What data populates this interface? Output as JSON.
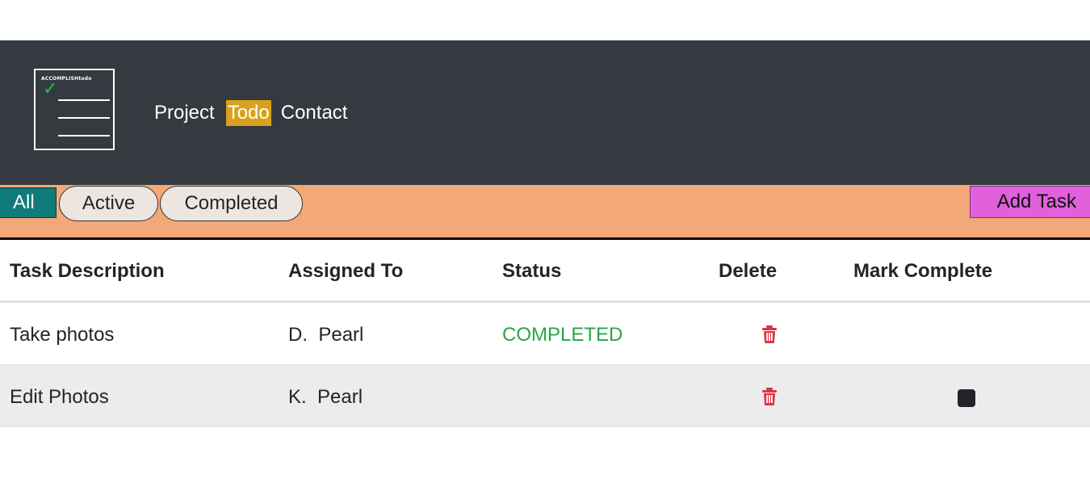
{
  "brand": {
    "logo_text": "ACCOMPLISHtodo",
    "check_glyph": "✓"
  },
  "nav": {
    "links": [
      {
        "label": "Project",
        "active": false
      },
      {
        "label": "Todo",
        "active": true
      },
      {
        "label": "Contact",
        "active": false
      }
    ]
  },
  "filters": {
    "all_label": "All",
    "active_label": "Active",
    "completed_label": "Completed",
    "add_task_label": "Add Task"
  },
  "table": {
    "headers": [
      "Task Description",
      "Assigned To",
      "Status",
      "Delete",
      "Mark Complete"
    ],
    "rows": [
      {
        "description": "Take photos",
        "assigned_to": "D.  Pearl",
        "status": "COMPLETED",
        "delete_icon": "trash-icon",
        "mark_complete": false
      },
      {
        "description": "Edit Photos",
        "assigned_to": "K.  Pearl",
        "status": "",
        "delete_icon": "trash-icon",
        "mark_complete": true
      }
    ]
  },
  "colors": {
    "navbar": "#343a40",
    "nav_active": "#d9a21c",
    "filterbar": "#f2a977",
    "all_tab": "#0f7b7a",
    "add_task": "#e160dc",
    "status_completed": "#28a745",
    "trash": "#dc3545"
  }
}
